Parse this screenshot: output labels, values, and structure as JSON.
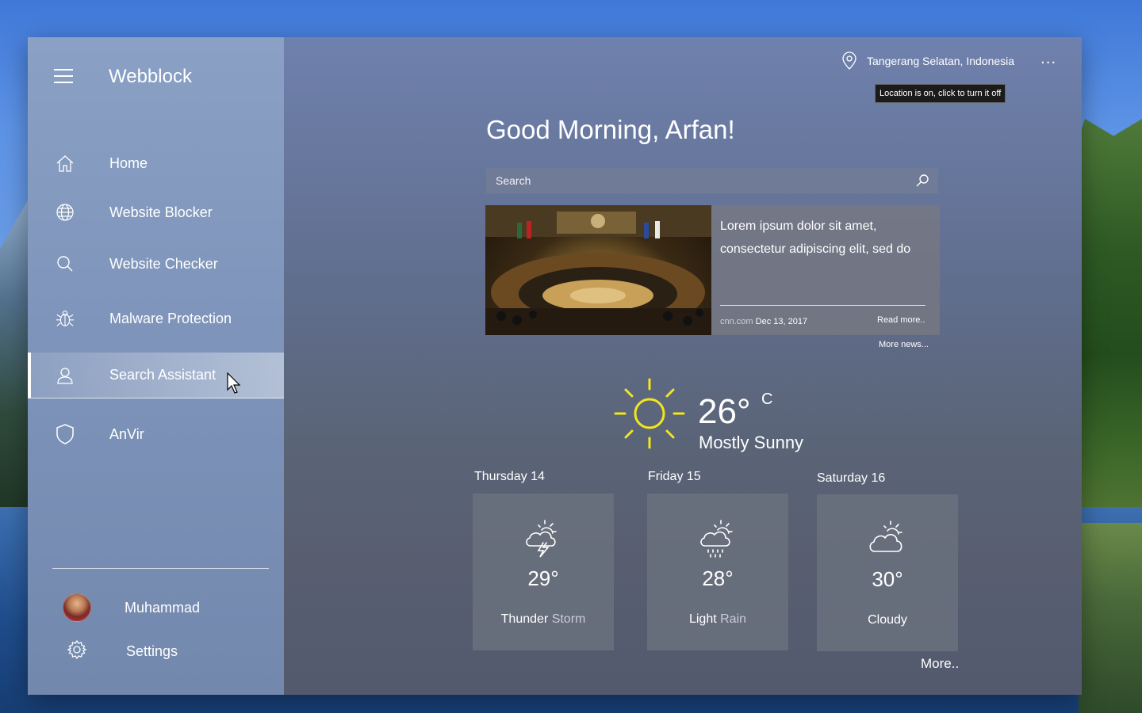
{
  "app": {
    "title": "Webblock"
  },
  "sidebar": {
    "items": [
      {
        "label": "Home",
        "icon": "home-icon"
      },
      {
        "label": "Website Blocker",
        "icon": "globe-icon"
      },
      {
        "label": "Website Checker",
        "icon": "search-icon"
      },
      {
        "label": "Malware Protection",
        "icon": "bug-icon"
      },
      {
        "label": "Search Assistant",
        "icon": "user-assistant-icon",
        "active": true
      },
      {
        "label": "AnVir",
        "icon": "shield-icon"
      }
    ],
    "user": {
      "name": "Muhammad"
    },
    "settings_label": "Settings"
  },
  "header": {
    "location": "Tangerang Selatan, Indonesia",
    "location_tooltip": "Location is on, click to turn it off",
    "more_icon": "more-dots-icon"
  },
  "greeting": "Good Morning, Arfan!",
  "search": {
    "placeholder": "Search"
  },
  "news": {
    "text": "Lorem ipsum dolor sit amet, consectetur adipiscing elit, sed do",
    "source": "cnn.com",
    "date": "Dec 13, 2017",
    "read_more": "Read more..",
    "more_news": "More news..."
  },
  "weather": {
    "current": {
      "temp": "26°",
      "unit": "C",
      "condition": "Mostly Sunny",
      "icon": "sun-icon"
    },
    "forecast": [
      {
        "day": "Thursday 14",
        "temp": "29°",
        "condition_main": "Thunder",
        "condition_sub": "Storm",
        "icon": "thunderstorm-icon"
      },
      {
        "day": "Friday 15",
        "temp": "28°",
        "condition_main": "Light",
        "condition_sub": "Rain",
        "icon": "rain-icon"
      },
      {
        "day": "Saturday 16",
        "temp": "30°",
        "condition_main": "Cloudy",
        "condition_sub": "",
        "icon": "cloudy-icon"
      }
    ],
    "more_label": "More.."
  },
  "colors": {
    "sun": "#f2e61c",
    "active_indicator": "#ffffff"
  }
}
